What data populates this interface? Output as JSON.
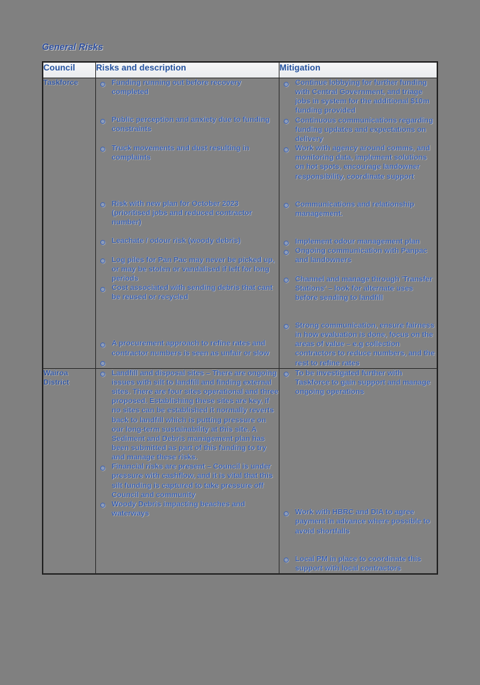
{
  "document": {
    "heading": "General Risks"
  },
  "table": {
    "columns": [
      {
        "key": "council",
        "label": "Council"
      },
      {
        "key": "risks",
        "label": "Risks and description"
      },
      {
        "key": "mitigation",
        "label": "Mitigation"
      }
    ],
    "rows": [
      {
        "council": "Taskforce",
        "risks": [
          "Funding running out before recovery completed",
          "Public perception and anxiety due to funding constraints",
          "Truck movements and dust resulting in complaints",
          "Risk with new plan for October 2023 (prioritised jobs and reduced contractor number)",
          "Leachate / odour risk (woody debris)",
          "Log piles for Pan Pac may never be picked up, or may be stolen or vandalised if left for long periods",
          "Cost associated with sending debris that cant be reused or recycled",
          "A procurement approach to refine rates and contractor numbers is seen as unfair or slow",
          ""
        ],
        "mitigation": [
          "Continue lobbying for further funding with Central Government, and triage jobs in system for the additional $10m funding provided",
          "Continuous communications regarding funding updates and expectations on delivery",
          "Work with agency around comms, and monitoring data, implement solutions on hot spots, encourage landowner responsibility, coordinate support",
          "Communications and relationship management.",
          "Implement odour management plan",
          "Ongoing communication with Panpac and landowners",
          "Channel and manage through 'Transfer Stations' – look for alternate uses before sending to landfill",
          "Strong communication, ensure fairness in how evaluation is done, focus on the areas of value – e.g collection contractors to reduce numbers, and the rest to refine rates"
        ]
      },
      {
        "council": "Wairoa District",
        "risks": [
          "Landfill and disposal sites – There are ongoing issues with silt to landfill and finding external sites. There are four sites operational and three proposed. Establishing these sites are key, if no sites can be established it normally reverts back to landfill which is putting pressure on our long-term sustainability at this site. A Sediment and Debris management plan has been submitted as part of this funding to try and manage these risks.",
          "Financial risks are present – Council is under pressure with cashflow, and it is vital that this silt funding is captured to take pressure off Council and community",
          "Woody Debris impacting beaches and waterways"
        ],
        "mitigation": [
          "To be investigated further with Taskforce to gain support and manage ongoing operations",
          "Work with HBRC and DIA to agree payment in advance where possible to avoid shortfalls",
          "Local PM in place to coordinate this support with local contractors"
        ]
      }
    ]
  },
  "colors": {
    "page_background": "#808080",
    "table_background": "#828282",
    "header_background": "#eef0f2",
    "heading_text": "#2a4b9b",
    "body_text": "#3a5fae",
    "border": "#2b2b2b"
  }
}
